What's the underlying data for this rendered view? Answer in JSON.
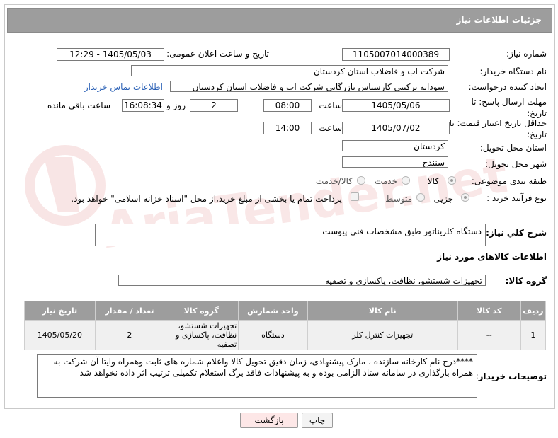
{
  "panel_title": "جزئیات اطلاعات نیاز",
  "fields": {
    "need_number": {
      "label": "شماره نیاز:",
      "value": "1105007014000389"
    },
    "announce_datetime": {
      "label": "تاریخ و ساعت اعلان عمومی:",
      "value": "1405/05/03 - 12:29"
    },
    "buyer_org": {
      "label": "نام دستگاه خریدار:",
      "value": "شرکت اب و فاضلاب استان کردستان"
    },
    "requester": {
      "label": "ایجاد کننده درخواست:",
      "value": "سودابه ترکیبی کارشناس بازرگانی شرکت اب و فاضلاب استان کردستان",
      "contact_link": "اطلاعات تماس خریدار"
    },
    "reply_deadline": {
      "label": "مهلت ارسال پاسخ: تا تاریخ:",
      "date": "1405/05/06",
      "time_label": "ساعت",
      "time": "08:00",
      "days": "2",
      "days_label": "روز و",
      "remaining": "16:08:34",
      "remaining_label": "ساعت باقی مانده"
    },
    "price_validity": {
      "label": "حداقل تاریخ اعتبار قیمت: تا تاریخ:",
      "date": "1405/07/02",
      "time_label": "ساعت",
      "time": "14:00"
    },
    "province": {
      "label": "استان محل تحویل:",
      "value": "کردستان"
    },
    "city": {
      "label": "شهر محل تحویل:",
      "value": "سنندج"
    },
    "category": {
      "label": "طبقه بندی موضوعی:",
      "options": [
        "کالا",
        "خدمت",
        "کالا/خدمت"
      ],
      "selected": "کالا"
    },
    "purchase_type": {
      "label": "نوع فرآیند خرید :",
      "options": [
        "جزیی",
        "متوسط"
      ],
      "selected": "جزیی",
      "payment_note": "پرداخت تمام یا بخشی از مبلغ خرید،از محل \"اسناد خزانه اسلامی\" خواهد بود."
    }
  },
  "summary": {
    "label": "شرح كلي نياز:",
    "value": "دستگاه کلریناتور طبق مشخصات فنی پیوست"
  },
  "goods_info_title": "اطلاعات کالاهای مورد نیاز",
  "goods_group": {
    "label": "گروه کالا:",
    "value": "تجهیزات شستشو، نظافت، پاکسازی و تصفیه"
  },
  "table": {
    "headers": [
      "ردیف",
      "کد کالا",
      "نام کالا",
      "واحد شمارش",
      "گروه کالا",
      "تعداد / مقدار",
      "تاریخ نیاز"
    ],
    "rows": [
      [
        "1",
        "--",
        "تجهیزات کنترل کلر",
        "دستگاه",
        "تجهیزات شستشو، نظافت، پاکسازی و تصفیه",
        "2",
        "1405/05/20"
      ]
    ]
  },
  "buyer_notes": {
    "label": "توضیحات خریدار:",
    "value": "****درج نام کارخانه سازنده ، مارک پیشنهادی، زمان دقیق تحویل کالا واعلام شماره های ثابت وهمراه وایتا آن شرکت به همراه بارگذاری در سامانه ستاد الزامی بوده و به پیشنهادات فاقد برگ استعلام تکمیلی ترتیب اثر داده نخواهد شد"
  },
  "buttons": {
    "print": "چاپ",
    "back": "بازگشت"
  },
  "watermark": {
    "text": "AriaTender.net"
  },
  "colors": {
    "header_bg": "#9d9d9d",
    "link": "#2b61b6",
    "back_bg": "#fde7e7",
    "print_bg": "#f3f3f3"
  }
}
